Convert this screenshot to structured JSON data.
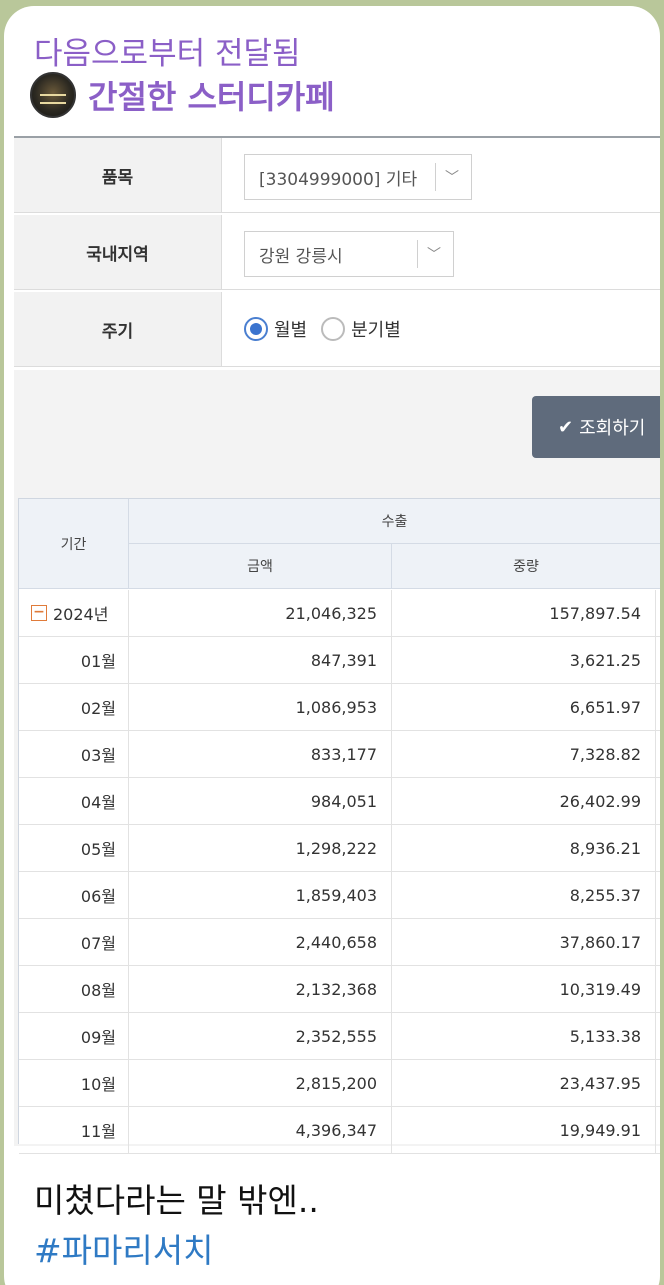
{
  "message": {
    "forwarded_label": "다음으로부터 전달됨",
    "channel_name": "간절한 스터디카페",
    "text": "미쳤다라는 말 밖엔..",
    "hashtag": "#파마리서치"
  },
  "form": {
    "item_label": "품목",
    "item_value": "[3304999000] 기타",
    "region_label": "국내지역",
    "region_value": "강원 강릉시",
    "period_label": "주기",
    "period_options": [
      "월별",
      "분기별"
    ],
    "period_selected": "월별",
    "search_button": "조회하기"
  },
  "table": {
    "headers": {
      "period": "기간",
      "export": "수출",
      "amount": "금액",
      "weight": "중량"
    },
    "rows": [
      {
        "period": "2024년",
        "amount": "21,046,325",
        "weight": "157,897.54"
      },
      {
        "period": "01월",
        "amount": "847,391",
        "weight": "3,621.25"
      },
      {
        "period": "02월",
        "amount": "1,086,953",
        "weight": "6,651.97"
      },
      {
        "period": "03월",
        "amount": "833,177",
        "weight": "7,328.82"
      },
      {
        "period": "04월",
        "amount": "984,051",
        "weight": "26,402.99"
      },
      {
        "period": "05월",
        "amount": "1,298,222",
        "weight": "8,936.21"
      },
      {
        "period": "06월",
        "amount": "1,859,403",
        "weight": "8,255.37"
      },
      {
        "period": "07월",
        "amount": "2,440,658",
        "weight": "37,860.17"
      },
      {
        "period": "08월",
        "amount": "2,132,368",
        "weight": "10,319.49"
      },
      {
        "period": "09월",
        "amount": "2,352,555",
        "weight": "5,133.38"
      },
      {
        "period": "10월",
        "amount": "2,815,200",
        "weight": "23,437.95"
      },
      {
        "period": "11월",
        "amount": "4,396,347",
        "weight": "19,949.91"
      }
    ]
  },
  "colors": {
    "accent_purple": "#8b5fc7",
    "hashtag_blue": "#2f7ac4",
    "button_gray": "#5f6b7c",
    "background_green": "#b9c79a"
  }
}
